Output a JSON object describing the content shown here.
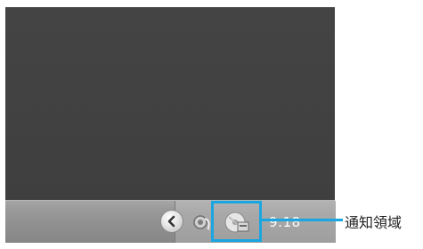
{
  "taskbar": {
    "clock_text": "9:18"
  },
  "tray": {
    "icons": [
      "network-icon",
      "cd-drive-icon"
    ],
    "expand_button_icon": "chevron-left-icon"
  },
  "annotation": {
    "label": "通知領域",
    "color": "#1aa6e0"
  },
  "colors": {
    "desktop": "#424242",
    "taskbar": "#9a9a9a"
  }
}
